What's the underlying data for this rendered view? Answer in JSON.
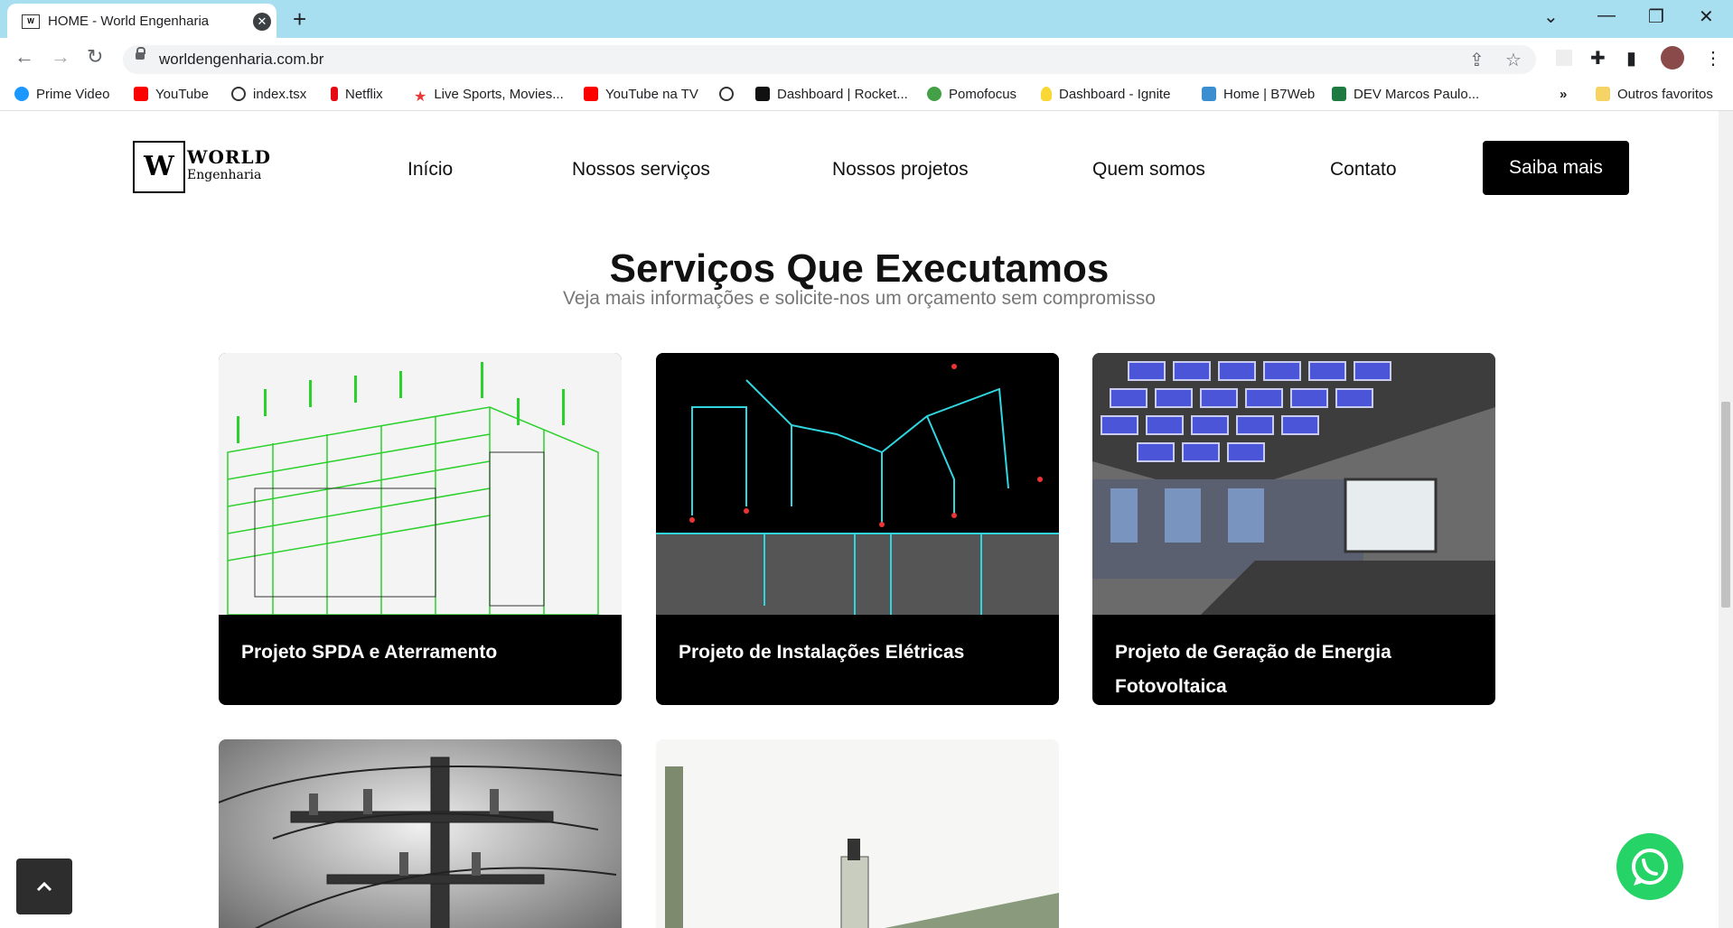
{
  "browser": {
    "tab_title": "HOME - World Engenharia",
    "url": "worldengenharia.com.br",
    "bookmarks": [
      {
        "label": "Prime Video",
        "color": "#1a98ff"
      },
      {
        "label": "YouTube",
        "color": "#ff0000"
      },
      {
        "label": "index.tsx",
        "color": "#333333"
      },
      {
        "label": "Netflix",
        "color": "#e50914"
      },
      {
        "label": "Live Sports, Movies...",
        "color": "#e53935"
      },
      {
        "label": "YouTube na TV",
        "color": "#ff0000"
      },
      {
        "label": "",
        "color": "#333333"
      },
      {
        "label": "Dashboard | Rocket...",
        "color": "#111111"
      },
      {
        "label": "Pomofocus",
        "color": "#43a047"
      },
      {
        "label": "Dashboard - Ignite",
        "color": "#f9d835"
      },
      {
        "label": "Home | B7Web",
        "color": "#3b8ed0"
      },
      {
        "label": "DEV Marcos Paulo...",
        "color": "#1d7a40"
      }
    ],
    "more_bookmarks": "»",
    "other_bookmarks": "Outros favoritos"
  },
  "site": {
    "logo_line1": "WORLD",
    "logo_line2": "Engenharia",
    "nav": [
      "Início",
      "Nossos serviços",
      "Nossos projetos",
      "Quem somos",
      "Contato"
    ],
    "cta": "Saiba mais",
    "section_title": "Serviços Que Executamos",
    "section_subtitle": "Veja mais informações e solicite-nos um orçamento sem compromisso",
    "cards": [
      {
        "label": "Projeto SPDA e Aterramento"
      },
      {
        "label": "Projeto de Instalações Elétricas"
      },
      {
        "label": "Projeto de Geração de Energia Fotovoltaica"
      }
    ]
  },
  "colors": {
    "accent": "#000000",
    "whatsapp": "#25d366",
    "titlebar": "#a8dff0"
  }
}
